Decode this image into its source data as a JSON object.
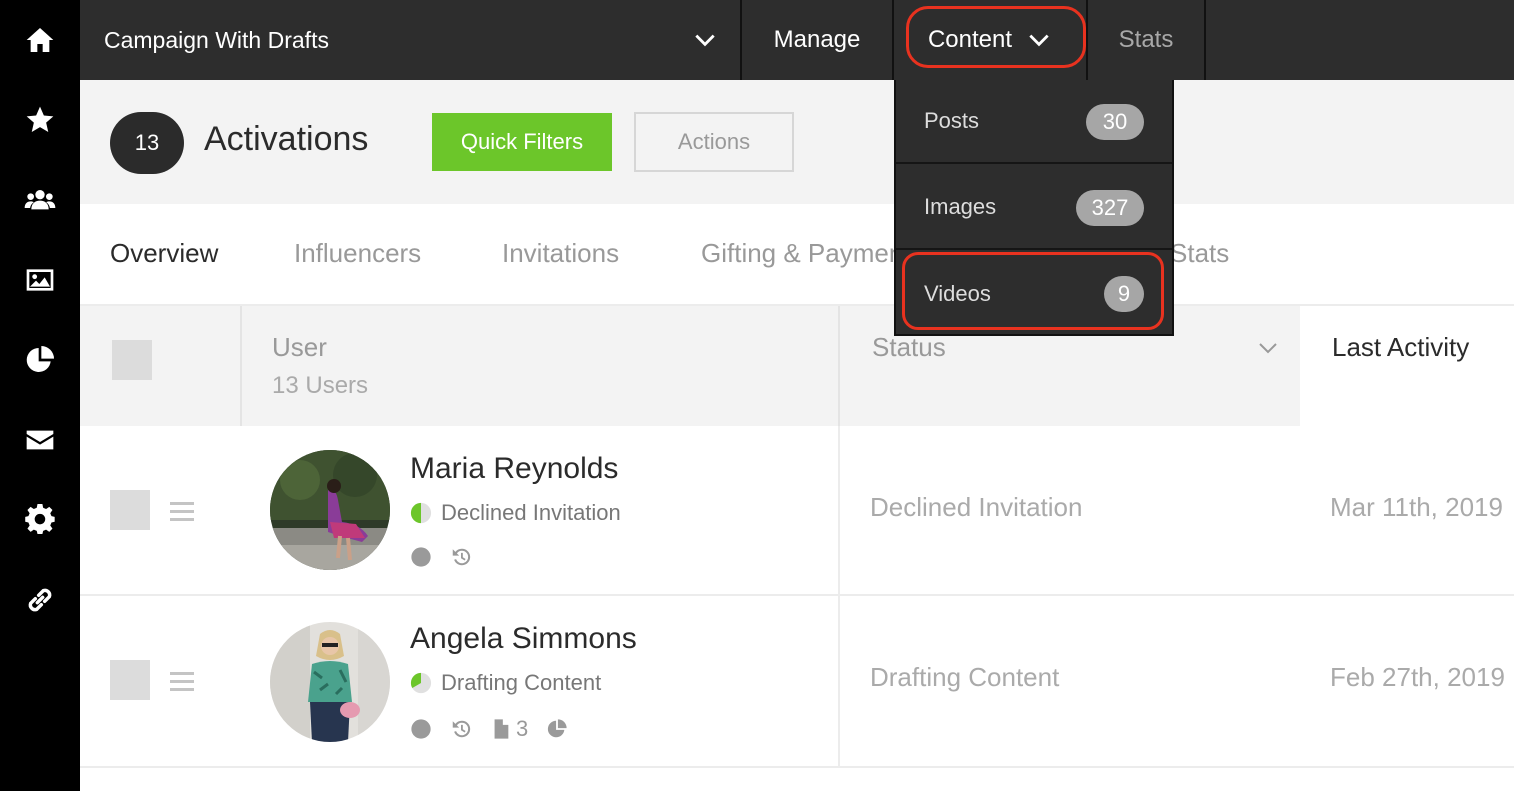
{
  "sidebar": {
    "icons": [
      "home-icon",
      "star-icon",
      "users-icon",
      "image-icon",
      "pie-chart-icon",
      "mail-icon",
      "gear-icon",
      "link-icon"
    ]
  },
  "topbar": {
    "campaign_title": "Campaign With Drafts",
    "nav": {
      "manage": "Manage",
      "content": "Content",
      "stats": "Stats"
    }
  },
  "header": {
    "count": "13",
    "title": "Activations",
    "quick_filters": "Quick Filters",
    "actions": "Actions"
  },
  "tabs": [
    "Overview",
    "Influencers",
    "Invitations",
    "Gifting & Payments",
    "Stats"
  ],
  "content_menu": {
    "items": [
      {
        "label": "Posts",
        "count": "30"
      },
      {
        "label": "Images",
        "count": "327"
      },
      {
        "label": "Videos",
        "count": "9"
      }
    ]
  },
  "table": {
    "columns": {
      "user": "User",
      "user_count": "13 Users",
      "status": "Status",
      "last_activity": "Last Activity"
    },
    "rows": [
      {
        "name": "Maria Reynolds",
        "sub_status": "Declined Invitation",
        "status": "Declined Invitation",
        "last_activity": "Mar 11th, 2019",
        "file_count": ""
      },
      {
        "name": "Angela Simmons",
        "sub_status": "Drafting Content",
        "status": "Drafting Content",
        "last_activity": "Feb 27th, 2019",
        "file_count": "3"
      }
    ]
  },
  "colors": {
    "accent_green": "#6cc62a",
    "highlight_red": "#e8321f",
    "topbar": "#2d2d2d"
  }
}
